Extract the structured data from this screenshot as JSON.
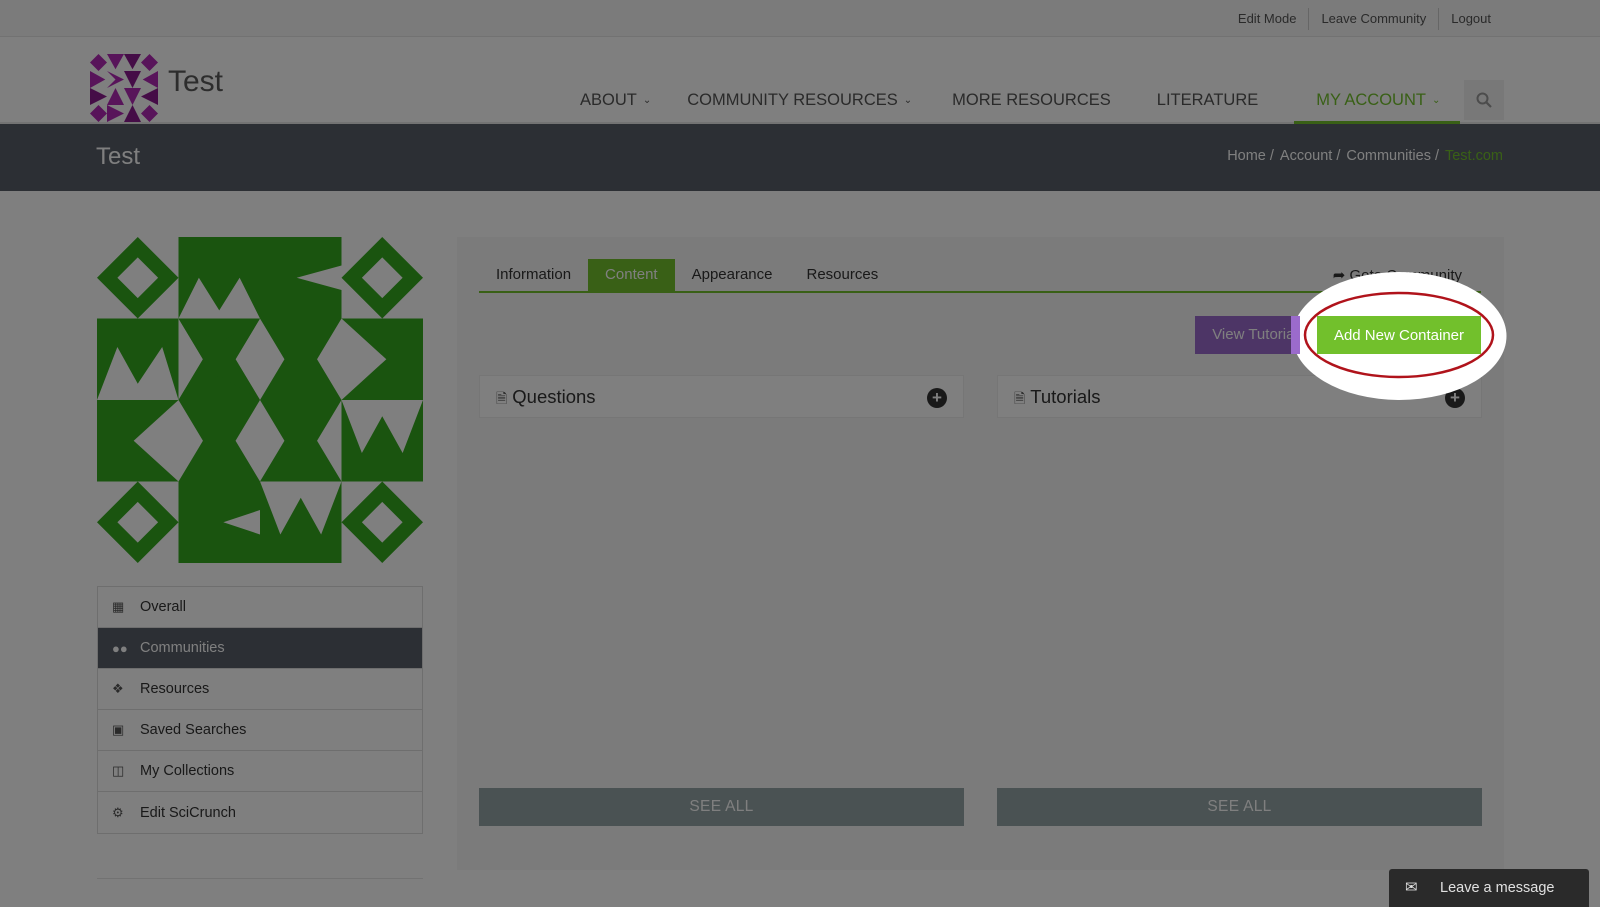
{
  "topbar": {
    "links": [
      "Edit Mode",
      "Leave Community",
      "Logout"
    ]
  },
  "header": {
    "site_name": "Test",
    "nav": [
      {
        "label": "ABOUT",
        "has_dropdown": true
      },
      {
        "label": "COMMUNITY RESOURCES",
        "has_dropdown": true
      },
      {
        "label": "MORE RESOURCES",
        "has_dropdown": false
      },
      {
        "label": "LITERATURE",
        "has_dropdown": false
      },
      {
        "label": "MY ACCOUNT",
        "has_dropdown": true,
        "active": true
      }
    ],
    "search_icon": "search-icon"
  },
  "crumbbar": {
    "title": "Test",
    "breadcrumbs": [
      "Home",
      "Account",
      "Communities",
      "Test.com"
    ]
  },
  "sidebar": {
    "items": [
      {
        "label": "Overall",
        "icon": "bar-chart-icon"
      },
      {
        "label": "Communities",
        "icon": "users-icon",
        "active": true
      },
      {
        "label": "Resources",
        "icon": "cubes-icon"
      },
      {
        "label": "Saved Searches",
        "icon": "floppy-disk-icon"
      },
      {
        "label": "My Collections",
        "icon": "folder-open-icon"
      },
      {
        "label": "Edit SciCrunch",
        "icon": "gears-icon"
      }
    ]
  },
  "main": {
    "tabs": [
      "Information",
      "Content",
      "Appearance",
      "Resources"
    ],
    "active_tab": "Content",
    "goto_label": "Goto Community",
    "view_tutorial_label": "View Tutorial",
    "add_container_label": "Add New Container",
    "boxes": [
      {
        "title": "Questions",
        "see_all": "SEE ALL"
      },
      {
        "title": "Tutorials",
        "see_all": "SEE ALL"
      }
    ]
  },
  "chat": {
    "label": "Leave a message"
  },
  "colors": {
    "accent": "#72c02c",
    "dark_bar": "#585f69",
    "tutorial_purple": "#9b6bcc",
    "avatar_green": "#34a81f",
    "logo_magenta": "#b129b4",
    "highlight_ring": "#b0131b"
  }
}
